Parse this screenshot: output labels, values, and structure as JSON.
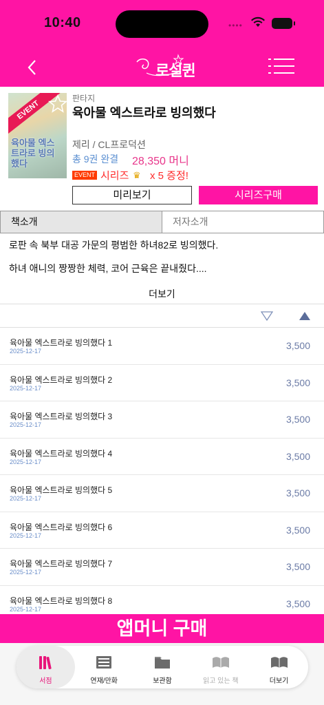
{
  "status_bar": {
    "time": "10:40"
  },
  "header": {
    "logo_text": "로설퀸"
  },
  "book": {
    "genre": "판타지",
    "title": "육아물 엑스트라로 빙의했다",
    "cover_badge": "EVENT",
    "cover_title": "육아물 엑스트라로 빙의했다",
    "author": "제리 / CL프로덕션",
    "volumes": "총 9권 완결",
    "price": "28,350 머니",
    "event_badge": "EVENT",
    "series_text": "시리즈",
    "bonus_text": "x 5 증정!",
    "preview_button": "미리보기",
    "series_buy_button": "시리즈구매"
  },
  "tabs": {
    "intro": "책소개",
    "author_intro": "저자소개"
  },
  "intro": {
    "line1": "로판 속 북부 대공 가문의 평범한 하녀82로 빙의했다.",
    "line2": "하녀 애니의 짱짱한 체력, 코어 근육은 끝내줬다....",
    "more": "더보기"
  },
  "episodes": [
    {
      "title": "육아물 엑스트라로 빙의했다 1",
      "date": "2025-12-17",
      "price": "3,500"
    },
    {
      "title": "육아물 엑스트라로 빙의했다 2",
      "date": "2025-12-17",
      "price": "3,500"
    },
    {
      "title": "육아물 엑스트라로 빙의했다 3",
      "date": "2025-12-17",
      "price": "3,500"
    },
    {
      "title": "육아물 엑스트라로 빙의했다 4",
      "date": "2025-12-17",
      "price": "3,500"
    },
    {
      "title": "육아물 엑스트라로 빙의했다 5",
      "date": "2025-12-17",
      "price": "3,500"
    },
    {
      "title": "육아물 엑스트라로 빙의했다 6",
      "date": "2025-12-17",
      "price": "3,500"
    },
    {
      "title": "육아물 엑스트라로 빙의했다 7",
      "date": "2025-12-17",
      "price": "3,500"
    },
    {
      "title": "육아물 엑스트라로 빙의했다 8",
      "date": "2025-12-17",
      "price": "3,500"
    }
  ],
  "buy_bar": "앱머니 구매",
  "tabbar": {
    "bookstore": "서점",
    "serial": "연재/만화",
    "library": "보관함",
    "reading": "읽고 있는 책",
    "more": "더보기"
  },
  "colors": {
    "brand_pink": "#ff14a4",
    "price_pink": "#e8358a",
    "event_red": "#ff2a2a"
  }
}
